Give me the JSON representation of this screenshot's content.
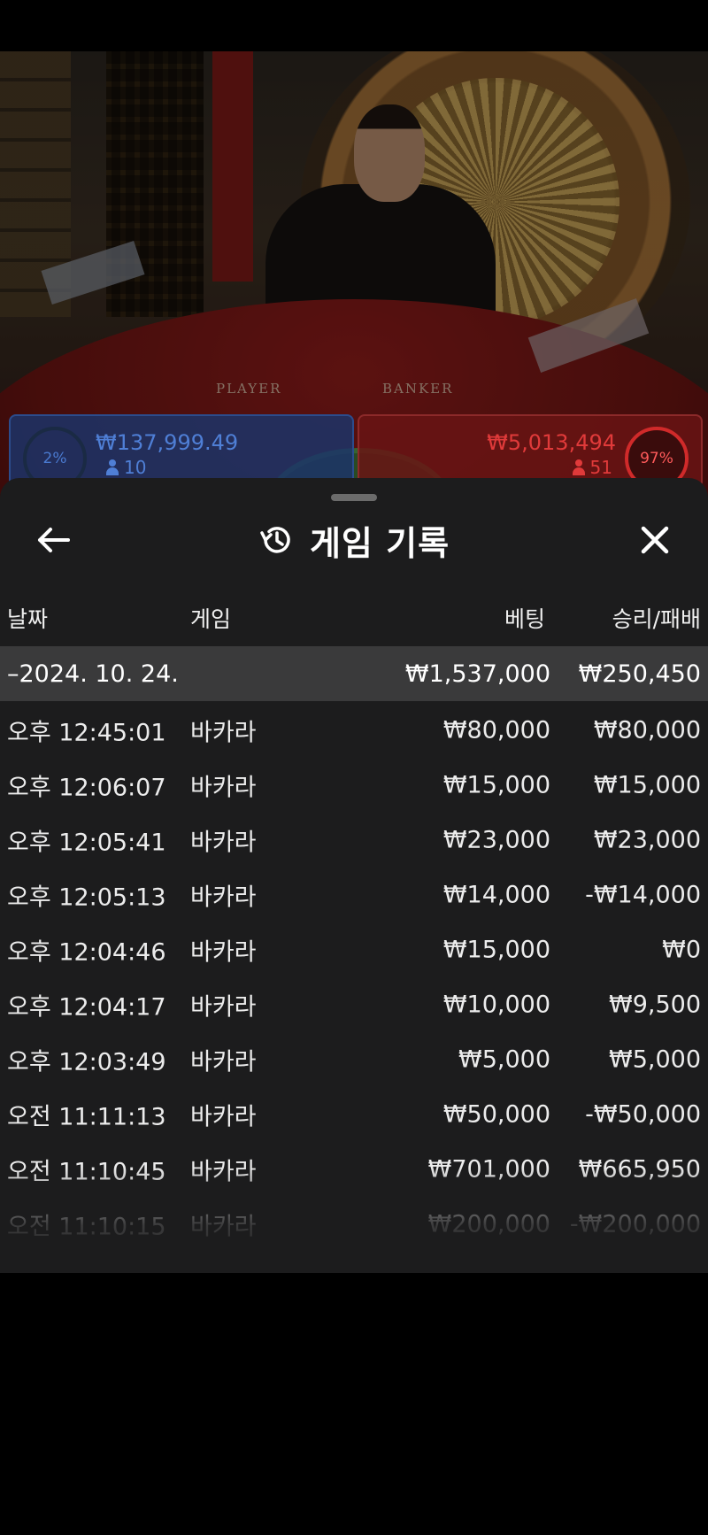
{
  "video": {
    "table_labels": {
      "player": "PLAYER",
      "banker": "BANKER"
    },
    "player_panel": {
      "percent": "2%",
      "amount": "₩137,999.49",
      "count": "10"
    },
    "banker_panel": {
      "percent": "97%",
      "amount": "₩5,013,494",
      "count": "51"
    }
  },
  "sheet": {
    "title": "게임 기록",
    "icons": {
      "back": "arrow-left-icon",
      "history": "history-icon",
      "close": "close-icon"
    },
    "columns": {
      "date": "날짜",
      "game": "게임",
      "bet": "베팅",
      "result": "승리/패배"
    },
    "date_group": {
      "label": "–2024. 10. 24.",
      "bet": "₩1,537,000",
      "result": "₩250,450"
    },
    "rows": [
      {
        "time": "오후 12:45:01",
        "game": "바카라",
        "bet": "₩80,000",
        "result": "₩80,000"
      },
      {
        "time": "오후 12:06:07",
        "game": "바카라",
        "bet": "₩15,000",
        "result": "₩15,000"
      },
      {
        "time": "오후 12:05:41",
        "game": "바카라",
        "bet": "₩23,000",
        "result": "₩23,000"
      },
      {
        "time": "오후 12:05:13",
        "game": "바카라",
        "bet": "₩14,000",
        "result": "-₩14,000"
      },
      {
        "time": "오후 12:04:46",
        "game": "바카라",
        "bet": "₩15,000",
        "result": "₩0"
      },
      {
        "time": "오후 12:04:17",
        "game": "바카라",
        "bet": "₩10,000",
        "result": "₩9,500"
      },
      {
        "time": "오후 12:03:49",
        "game": "바카라",
        "bet": "₩5,000",
        "result": "₩5,000"
      },
      {
        "time": "오전 11:11:13",
        "game": "바카라",
        "bet": "₩50,000",
        "result": "-₩50,000"
      },
      {
        "time": "오전 11:10:45",
        "game": "바카라",
        "bet": "₩701,000",
        "result": "₩665,950"
      },
      {
        "time": "오전 11:10:15",
        "game": "바카라",
        "bet": "₩200,000",
        "result": "-₩200,000"
      }
    ]
  }
}
